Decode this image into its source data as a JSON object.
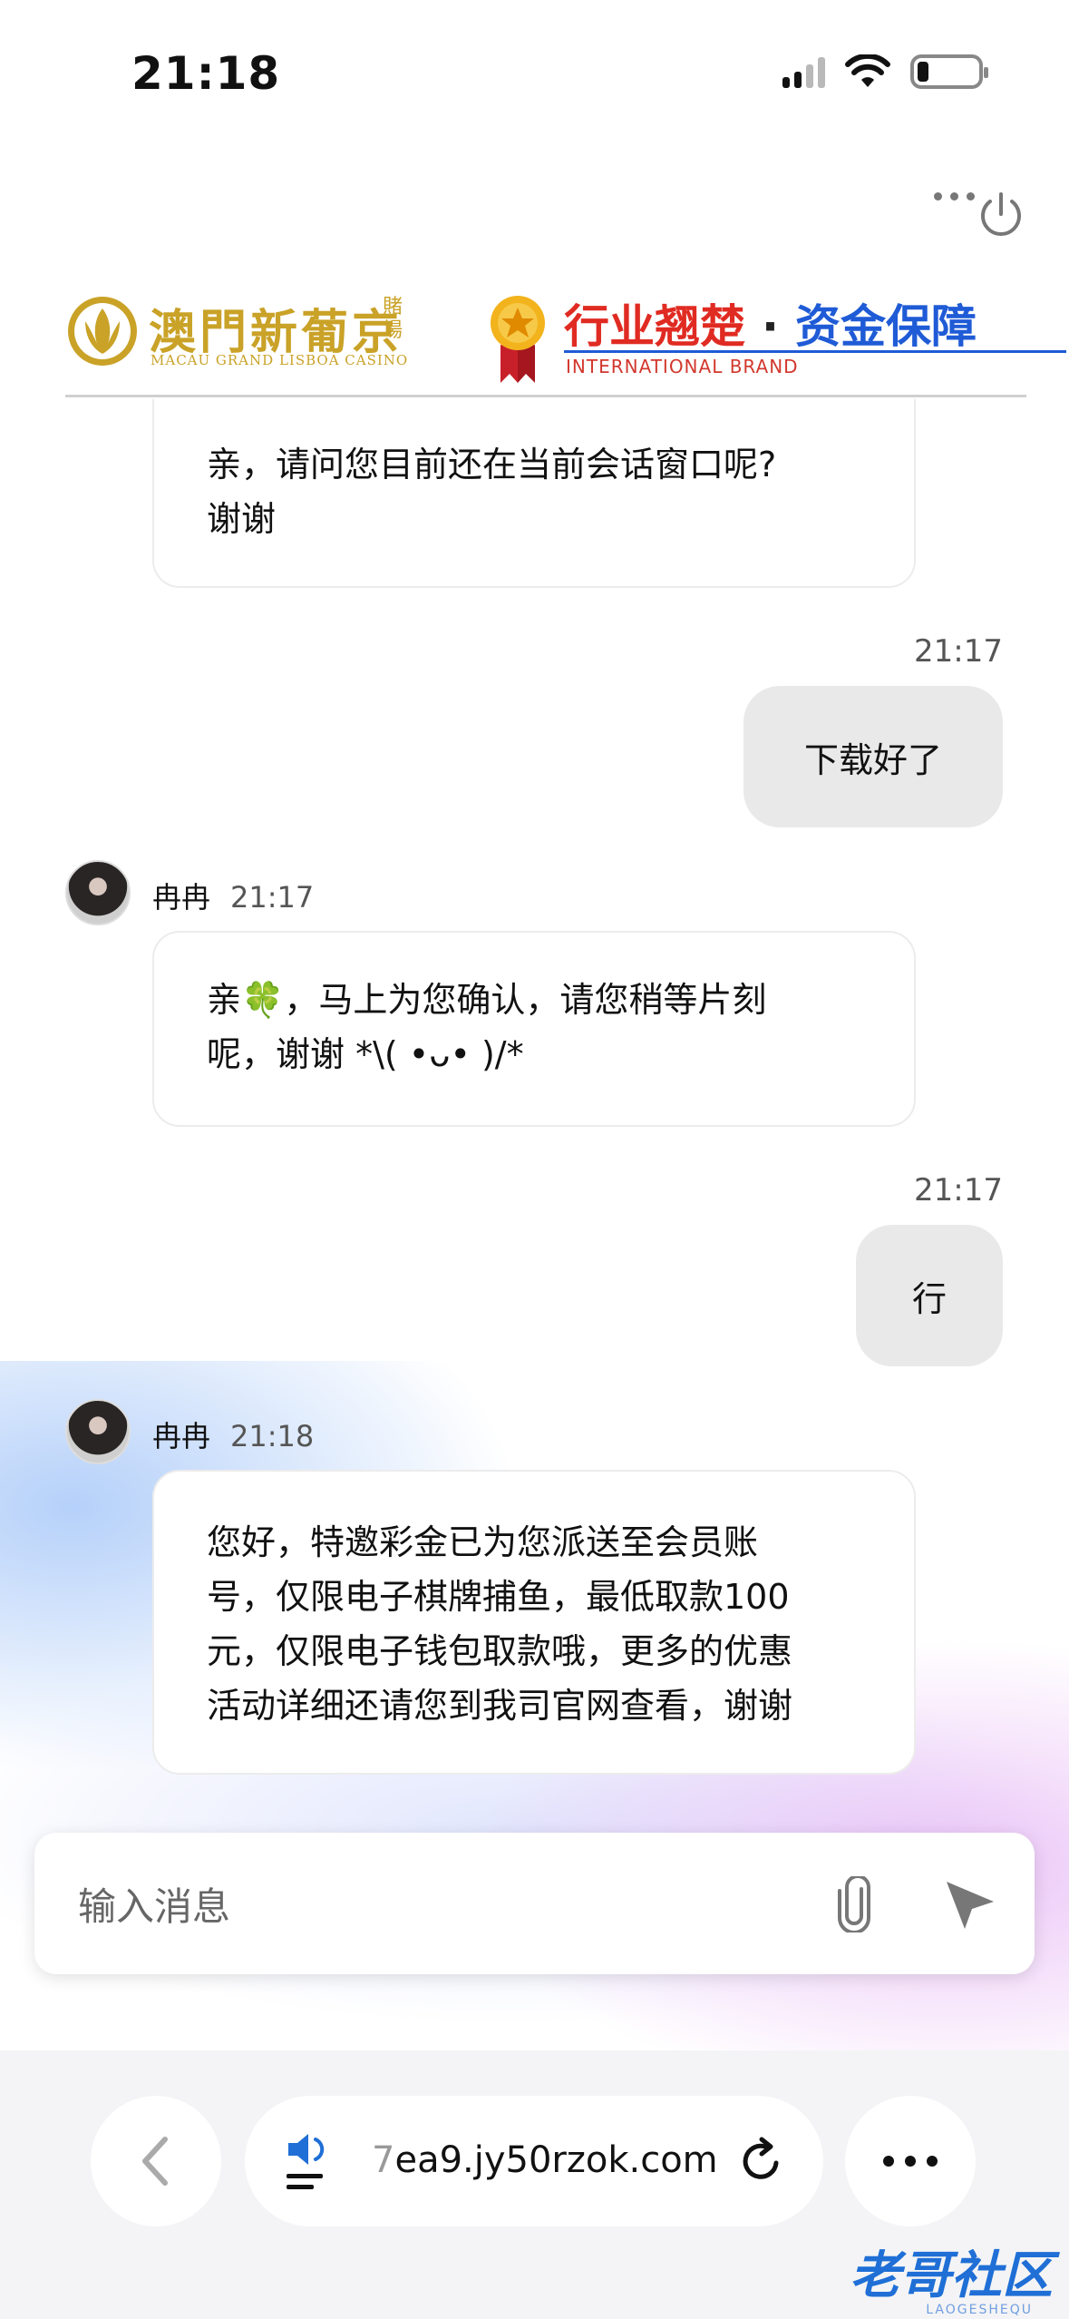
{
  "status_bar": {
    "time": "21:18"
  },
  "banner": {
    "casino_name_cn": "澳門新葡京",
    "casino_name_small": "賭場",
    "casino_name_en": "MACAU GRAND LISBOA CASINO",
    "slogan_part1": "行业翘楚",
    "slogan_sep": "·",
    "slogan_part2": "资金保障",
    "slogan_en": "INTERNATIONAL BRAND"
  },
  "chat": {
    "messages": [
      {
        "from": "agent",
        "text_lines": [
          "亲，请问您目前还在当前会话窗口呢?",
          "谢谢"
        ]
      },
      {
        "from": "user",
        "time": "21:17",
        "text": "下载好了"
      },
      {
        "from": "agent",
        "name": "冉冉",
        "time": "21:17",
        "text_lines": [
          "亲🍀，马上为您确认，请您稍等片刻",
          "呢，谢谢 *\\( •ᴗ• )/*"
        ]
      },
      {
        "from": "user",
        "time": "21:17",
        "text": "行"
      },
      {
        "from": "agent",
        "name": "冉冉",
        "time": "21:18",
        "text_lines": [
          "您好，特邀彩金已为您派送至会员账",
          "号，仅限电子棋牌捕鱼，最低取款100",
          "元，仅限电子钱包取款哦，更多的优惠",
          "活动详细还请您到我司官网查看，谢谢"
        ]
      }
    ]
  },
  "input": {
    "placeholder": "输入消息"
  },
  "browser": {
    "url_prefix": "7",
    "url": "ea9.jy50rzok.com"
  },
  "watermark": {
    "text": "老哥社区",
    "sub": "LAOGESHEQU"
  }
}
